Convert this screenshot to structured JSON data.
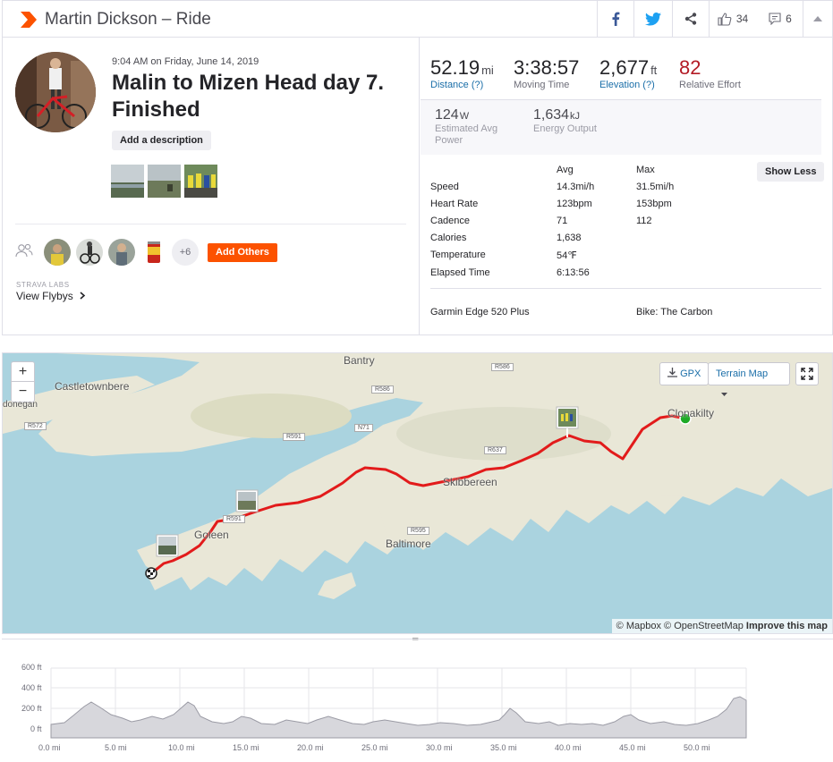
{
  "header": {
    "title": "Martin Dickson – Ride",
    "kudos_count": "34",
    "comment_count": "6"
  },
  "activity": {
    "datetime": "9:04 AM on Friday, June 14, 2019",
    "name": "Malin to Mizen Head day 7. Finished",
    "add_description": "Add a description",
    "more_athletes": "+6",
    "add_others": "Add Others",
    "labs_label": "STRAVA LABS",
    "flybys_label": "View Flybys"
  },
  "stats": {
    "distance": {
      "value": "52.19",
      "unit": "mi",
      "label": "Distance (?)"
    },
    "moving_time": {
      "value": "3:38:57",
      "label": "Moving Time"
    },
    "elevation": {
      "value": "2,677",
      "unit": "ft",
      "label": "Elevation (?)"
    },
    "relative_effort": {
      "value": "82",
      "label": "Relative Effort"
    },
    "power": {
      "value": "124",
      "unit": "W",
      "label_line1": "Estimated Avg",
      "label_line2": "Power"
    },
    "energy": {
      "value": "1,634",
      "unit": "kJ",
      "label": "Energy Output"
    }
  },
  "details": {
    "col_avg": "Avg",
    "col_max": "Max",
    "show_less": "Show Less",
    "rows": [
      {
        "label": "Speed",
        "avg": "14.3mi/h",
        "max": "31.5mi/h"
      },
      {
        "label": "Heart Rate",
        "avg": "123bpm",
        "max": "153bpm"
      },
      {
        "label": "Cadence",
        "avg": "71",
        "max": "112"
      },
      {
        "label": "Calories",
        "avg": "1,638",
        "max": ""
      },
      {
        "label": "Temperature",
        "avg": "54℉",
        "max": ""
      },
      {
        "label": "Elapsed Time",
        "avg": "6:13:56",
        "max": ""
      }
    ],
    "device": "Garmin Edge 520 Plus",
    "bike": "Bike: The Carbon"
  },
  "map": {
    "zoom_in": "+",
    "zoom_out": "−",
    "gpx": "GPX",
    "terrain": "Terrain Map",
    "attribution_mapbox": "© Mapbox",
    "attribution_osm": "© OpenStreetMap",
    "improve": "Improve this map",
    "places": {
      "bantry": "Bantry",
      "castletownbere": "Castletownbere",
      "donegan": "donegan",
      "clonakilty": "Clonakilty",
      "skibbereen": "Skibbereen",
      "goleen": "Goleen",
      "baltimore": "Baltimore"
    },
    "roads": {
      "r586": "R586",
      "r586b": "R586",
      "r572": "R572",
      "r591": "R591",
      "n71": "N71",
      "r637": "R637",
      "r595": "R595",
      "r591b": "R591"
    }
  },
  "elevation_chart": {
    "y_ticks": [
      "600 ft",
      "400 ft",
      "200 ft",
      "0 ft"
    ],
    "x_ticks": [
      "0.0 mi",
      "5.0 mi",
      "10.0 mi",
      "15.0 mi",
      "20.0 mi",
      "25.0 mi",
      "30.0 mi",
      "35.0 mi",
      "40.0 mi",
      "45.0 mi",
      "50.0 mi"
    ]
  },
  "colors": {
    "brand": "#fc5200",
    "link": "#1a6ea8",
    "effort": "#b31b25",
    "route": "#e21b1b",
    "water": "#aad3df",
    "land": "#e9e7d7"
  }
}
